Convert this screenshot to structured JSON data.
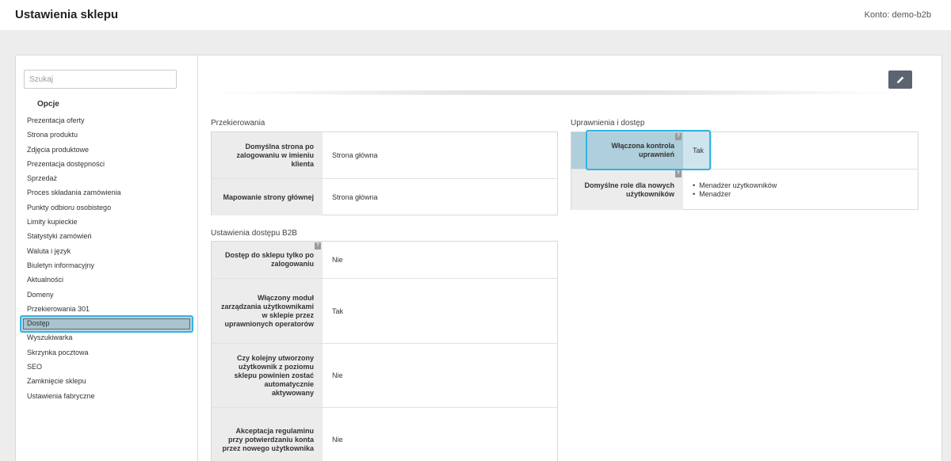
{
  "header": {
    "title": "Ustawienia sklepu",
    "account": "Konto: demo-b2b"
  },
  "sidebar": {
    "search_placeholder": "Szukaj",
    "section_title": "Opcje",
    "items": [
      "Prezentacja oferty",
      "Strona produktu",
      "Zdjęcia produktowe",
      "Prezentacja dostępności",
      "Sprzedaż",
      "Proces składania zamówienia",
      "Punkty odbioru osobistego",
      "Limity kupieckie",
      "Statystyki zamówień",
      "Waluta i język",
      "Biuletyn informacyjny",
      "Aktualności",
      "Domeny",
      "Przekierowania 301",
      "Dostęp",
      "Wyszukiwarka",
      "Skrzynka pocztowa",
      "SEO",
      "Zamknięcie sklepu",
      "Ustawienia fabryczne"
    ],
    "active_item": "Dostęp"
  },
  "toolbar": {
    "edit_icon": "pencil-icon"
  },
  "redirects": {
    "title": "Przekierowania",
    "rows": [
      {
        "label": "Domyślna strona po zalogowaniu w imieniu klienta",
        "value": "Strona główna"
      },
      {
        "label": "Mapowanie strony głównej",
        "value": "Strona główna"
      }
    ]
  },
  "b2b": {
    "title": "Ustawienia dostępu B2B",
    "rows": [
      {
        "label": "Dostęp do sklepu tylko po zalogowaniu",
        "value": "Nie"
      },
      {
        "label": "Włączony moduł zarządzania użytkownikami w sklepie przez uprawnionych operatorów",
        "value": "Tak"
      },
      {
        "label": "Czy kolejny utworzony użytkownik z poziomu sklepu powinien zostać automatycznie aktywowany",
        "value": "Nie"
      },
      {
        "label": "Akceptacja regulaminu przy potwierdzaniu konta przez nowego użytkownika",
        "value": "Nie"
      }
    ]
  },
  "permissions": {
    "title": "Uprawnienia i dostęp",
    "rows": [
      {
        "label": "Włączona kontrola uprawnień",
        "value": "Tak"
      },
      {
        "label": "Domyślne role dla nowych użytkowników",
        "values": [
          "Menadżer użytkowników",
          "Menadżer"
        ]
      }
    ]
  },
  "help_glyph": "?",
  "colors": {
    "accent_focus": "#33b3e3",
    "edit_button": "#5b6470",
    "label_bg": "#ececec"
  }
}
